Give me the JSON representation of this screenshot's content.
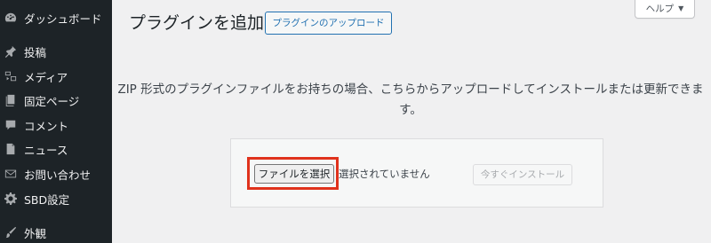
{
  "sidebar": {
    "items": [
      {
        "label": "ダッシュボード",
        "icon": "dashboard-icon"
      },
      {
        "label": "投稿",
        "icon": "pin-icon"
      },
      {
        "label": "メディア",
        "icon": "media-icon"
      },
      {
        "label": "固定ページ",
        "icon": "page-icon"
      },
      {
        "label": "コメント",
        "icon": "comment-icon"
      },
      {
        "label": "ニュース",
        "icon": "edit-page-icon"
      },
      {
        "label": "お問い合わせ",
        "icon": "mail-icon"
      },
      {
        "label": "SBD設定",
        "icon": "gear-icon"
      },
      {
        "label": "外観",
        "icon": "brush-icon"
      }
    ]
  },
  "header": {
    "title": "プラグインを追加",
    "upload_button": "プラグインのアップロード",
    "help_label": "ヘルプ",
    "help_caret": "▼"
  },
  "main": {
    "description": "ZIP 形式のプラグインファイルをお持ちの場合、こちらからアップロードしてインストールまたは更新できます。",
    "choose_file_label": "ファイルを選択",
    "no_file_text": "選択されていません",
    "install_button": "今すぐインストール"
  },
  "colors": {
    "sidebar_bg": "#1d2327",
    "accent": "#2271b1",
    "highlight": "#e0321c",
    "page_bg": "#f0f0f1"
  }
}
